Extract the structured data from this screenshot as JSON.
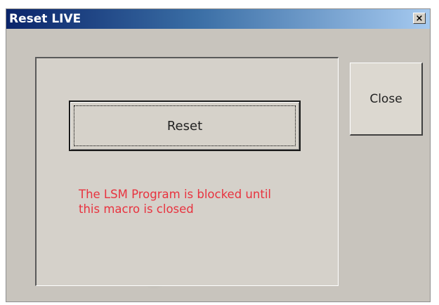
{
  "window": {
    "title": "Reset LIVE",
    "title_close_glyph": "×",
    "title_close_icon": "close-icon"
  },
  "main": {
    "reset_label": "Reset",
    "message_line1": "The LSM Program is blocked until",
    "message_line2": "this macro is closed",
    "message_color": "#e8333f"
  },
  "sidebar": {
    "close_label": "Close"
  }
}
